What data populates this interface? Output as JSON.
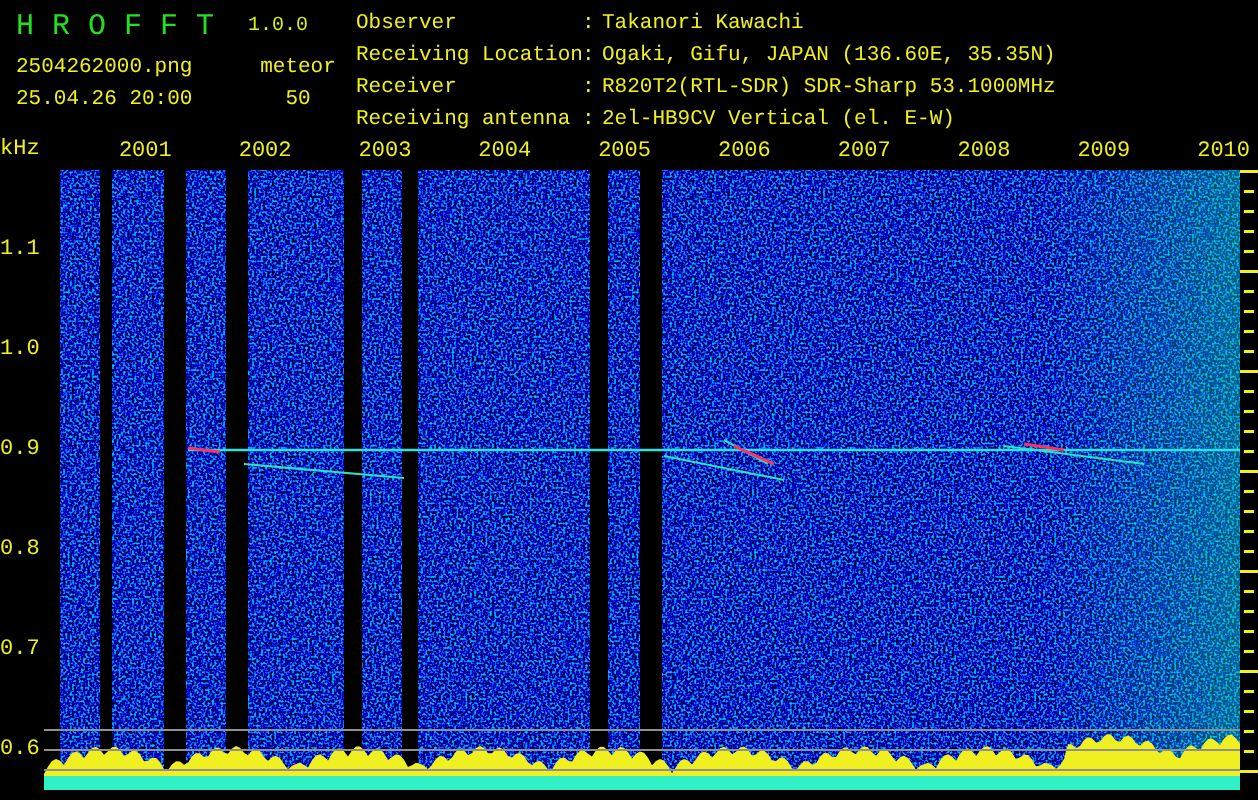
{
  "app": {
    "name": "H R O F F T",
    "version": "1.0.0"
  },
  "file": {
    "name": "2504262000.png",
    "datetime": "25.04.26 20:00"
  },
  "count": {
    "label": "meteor",
    "value": "50"
  },
  "info": [
    {
      "label": "Observer",
      "separator": ":",
      "value": "Takanori Kawachi"
    },
    {
      "label": "Receiving Location",
      "separator": ":",
      "value": "Ogaki, Gifu, JAPAN (136.60E, 35.35N)"
    },
    {
      "label": "Receiver",
      "separator": ":",
      "value": "R820T2(RTL-SDR) SDR-Sharp 53.1000MHz"
    },
    {
      "label": "Receiving antenna",
      "separator": ":",
      "value": "2el-HB9CV Vertical (el. E-W)"
    }
  ],
  "axis": {
    "unit": "kHz",
    "y_labels": [
      "1.1",
      "1.0",
      "0.9",
      "0.8",
      "0.7",
      "0.6"
    ],
    "x_labels": [
      "2001",
      "2002",
      "2003",
      "2004",
      "2005",
      "2006",
      "2007",
      "2008",
      "2009",
      "2010"
    ]
  }
}
